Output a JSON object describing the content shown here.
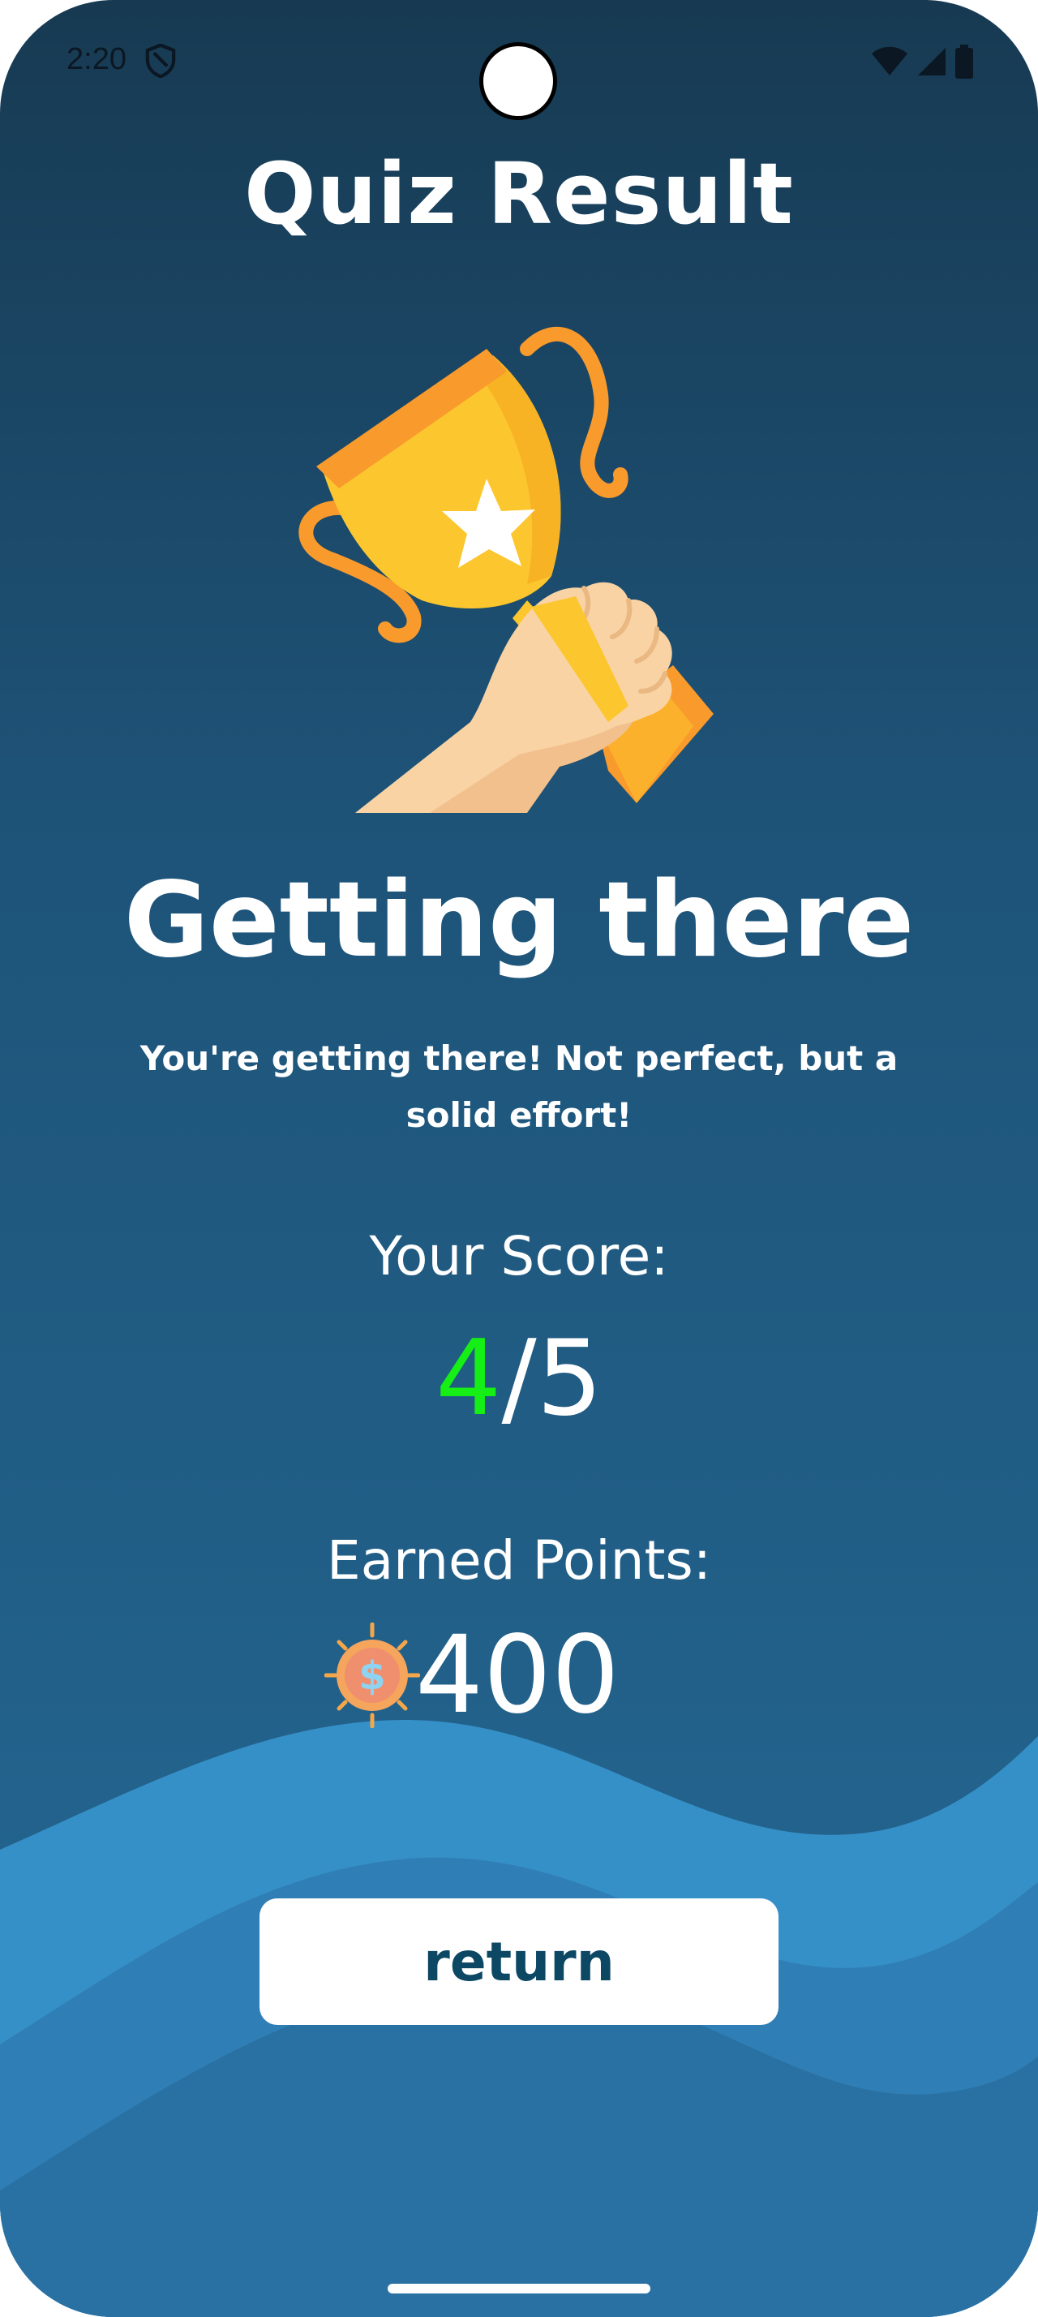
{
  "status_bar": {
    "time": "2:20",
    "icons": [
      "shield-icon",
      "wifi-icon",
      "signal-icon",
      "battery-icon"
    ]
  },
  "page": {
    "title": "Quiz Result"
  },
  "result": {
    "title": "Getting there",
    "message": "You're getting there! Not perfect, but a solid effort!"
  },
  "score": {
    "label": "Your Score:",
    "correct": "4",
    "total": "/5"
  },
  "points": {
    "label": "Earned Points:",
    "value": "400",
    "icon": "coin-icon"
  },
  "actions": {
    "return_label": "return"
  },
  "colors": {
    "background_top": "#173a52",
    "background_bottom": "#246a96",
    "wave": "#3a8fc6",
    "score_correct": "#16ef16",
    "button_text": "#0c4763"
  }
}
